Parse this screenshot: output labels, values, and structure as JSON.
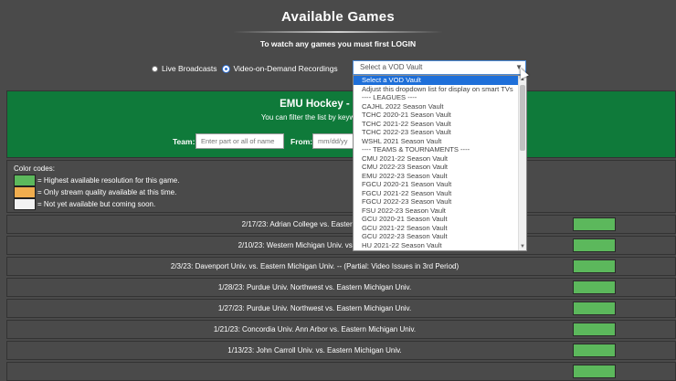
{
  "header": {
    "title": "Available Games",
    "subtitle": "To watch any games you must first LOGIN"
  },
  "mode": {
    "live_label": "Live Broadcasts",
    "vod_label": "Video-on-Demand Recordings",
    "selected": "vod"
  },
  "vault_select": {
    "value": "Select a VOD Vault",
    "options": [
      "Select a VOD Vault",
      "Adjust this dropdown list for display on smart TVs",
      "---- LEAGUES ----",
      "CAJHL 2022 Season Vault",
      "TCHC 2020-21 Season Vault",
      "TCHC 2021-22 Season Vault",
      "TCHC 2022-23 Season Vault",
      "WSHL 2021 Season Vault",
      "---- TEAMS & TOURNAMENTS ----",
      "CMU 2021-22 Season Vault",
      "CMU 2022-23 Season Vault",
      "EMU 2022-23 Season Vault",
      "FGCU 2020-21 Season Vault",
      "FGCU 2021-22 Season Vault",
      "FGCU 2022-23 Season Vault",
      "FSU 2022-23 Season Vault",
      "GCU 2020-21 Season Vault",
      "GCU 2021-22 Season Vault",
      "GCU 2022-23 Season Vault",
      "HU 2021-22 Season Vault"
    ]
  },
  "panel": {
    "title": "EMU Hockey - Eastern M",
    "filter_hint": "You can filter the list by keyword(s) and/or date ra",
    "team_label": "Team:",
    "team_placeholder": "Enter part or all of name",
    "from_label": "From:",
    "from_placeholder": "mm/dd/yy"
  },
  "legend": {
    "heading": "Color codes:",
    "items": [
      {
        "color": "#5cb85c",
        "text": "= Highest available resolution for this game."
      },
      {
        "color": "#f0ad4e",
        "text": "= Only stream quality available at this time."
      },
      {
        "color": "#f2f2f2",
        "text": "= Not yet available but coming soon."
      }
    ]
  },
  "games": [
    "2/17/23: Adrian College vs. Eastern Michigan",
    "2/10/23: Western Michigan Univ. vs. Eastern Mi",
    "2/3/23: Davenport Univ. vs. Eastern Michigan Univ. -- (Partial: Video Issues in 3rd Period)",
    "1/28/23: Purdue Univ. Northwest vs. Eastern Michigan Univ.",
    "1/27/23: Purdue Univ. Northwest vs. Eastern Michigan Univ.",
    "1/21/23: Concordia Univ. Ann Arbor vs. Eastern Michigan Univ.",
    "1/13/23: John Carroll Univ. vs. Eastern Michigan Univ."
  ],
  "colors": {
    "available": "#5cb85c",
    "panel_green": "#0f7a3a",
    "background": "#4a4a4a",
    "highlight": "#1e6fd9"
  }
}
